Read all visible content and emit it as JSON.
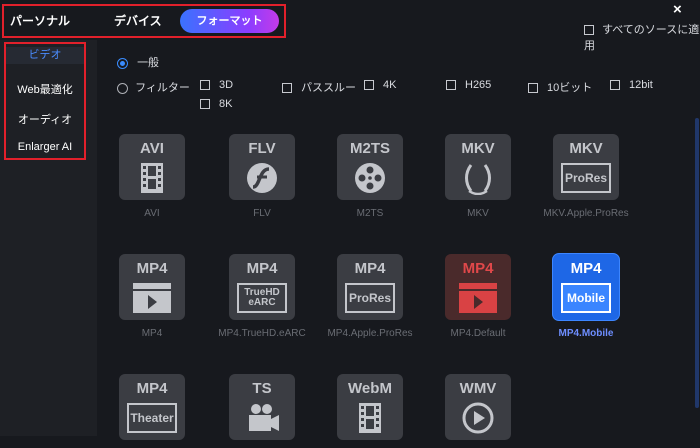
{
  "header": {
    "tabs": [
      "パーソナル",
      "デバイス",
      "フォーマット"
    ],
    "close": "×",
    "all_sources_label": "すべてのソースに適用"
  },
  "sidebar": {
    "items": [
      "ビデオ",
      "Web最適化",
      "オーディオ",
      "Enlarger AI"
    ]
  },
  "filters": {
    "general": "一般",
    "filter": "フィルター",
    "options": [
      "3D",
      "パススルー",
      "4K",
      "H265",
      "10ビット",
      "12bit",
      "8K"
    ]
  },
  "formats": [
    {
      "title": "AVI",
      "label": "AVI",
      "icon": "film-icon"
    },
    {
      "title": "FLV",
      "label": "FLV",
      "icon": "flash-icon"
    },
    {
      "title": "M2TS",
      "label": "M2TS",
      "icon": "reel-icon"
    },
    {
      "title": "MKV",
      "label": "MKV",
      "icon": "matroska-icon"
    },
    {
      "title": "MKV",
      "label": "MKV.Apple.ProRes",
      "sub": "ProRes",
      "icon": "prores-badge"
    },
    {
      "title": "MP4",
      "label": "MP4",
      "icon": "play-screen-icon"
    },
    {
      "title": "MP4",
      "label": "MP4.TrueHD.eARC",
      "sub": "TrueHD\neARC",
      "icon": "truehd-badge"
    },
    {
      "title": "MP4",
      "label": "MP4.Apple.ProRes",
      "sub": "ProRes",
      "icon": "prores-badge"
    },
    {
      "title": "MP4",
      "label": "MP4.Default",
      "icon": "play-screen-icon",
      "style": "red"
    },
    {
      "title": "MP4",
      "label": "MP4.Mobile",
      "sub": "Mobile",
      "icon": "mobile-badge",
      "style": "blue"
    },
    {
      "title": "MP4",
      "label": "",
      "sub": "Theater",
      "icon": "theater-badge"
    },
    {
      "title": "TS",
      "label": "",
      "icon": "camera-icon"
    },
    {
      "title": "WebM",
      "label": "",
      "icon": "film-icon"
    },
    {
      "title": "WMV",
      "label": "",
      "icon": "play-circle-icon"
    }
  ],
  "colors": {
    "accent": "#3a8cff",
    "highlight": "#e2202b",
    "selected_tile": "#1e67e6"
  }
}
